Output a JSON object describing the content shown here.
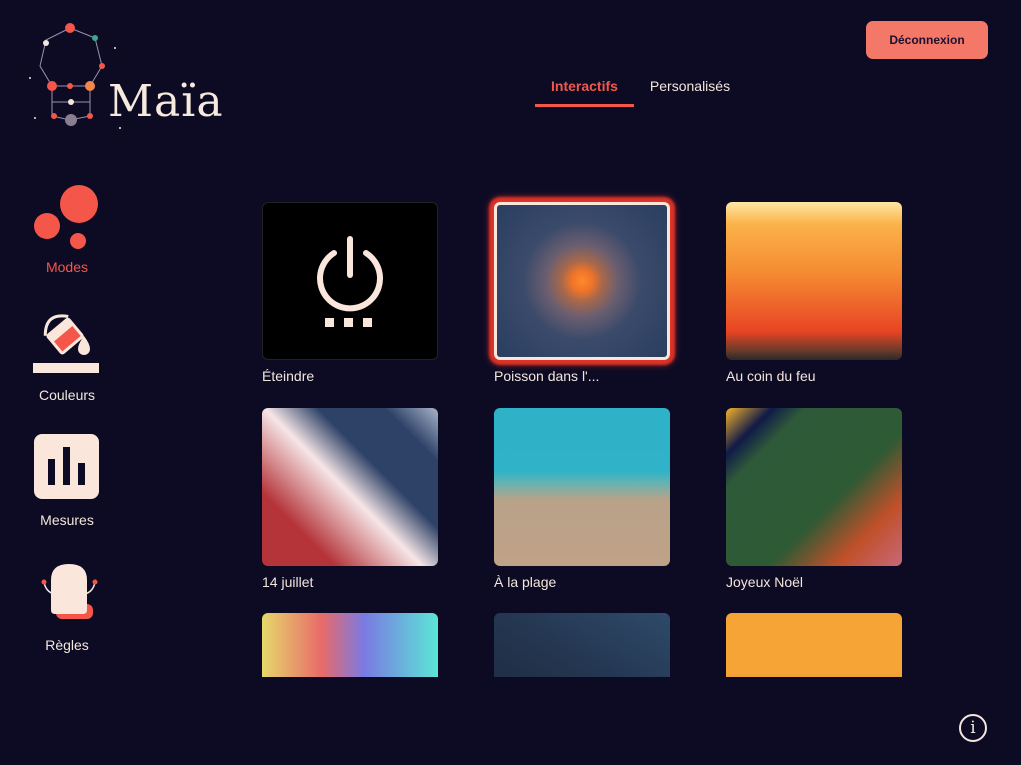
{
  "app": {
    "name": "Maïa",
    "logout_label": "Déconnexion"
  },
  "tabs": [
    {
      "label": "Interactifs",
      "active": true
    },
    {
      "label": "Personalisés",
      "active": false
    }
  ],
  "sidebar": {
    "items": [
      {
        "label": "Modes",
        "icon": "modes-bubbles-icon",
        "active": true
      },
      {
        "label": "Couleurs",
        "icon": "paint-bucket-icon",
        "active": false
      },
      {
        "label": "Mesures",
        "icon": "bar-chart-icon",
        "active": false
      },
      {
        "label": "Règles",
        "icon": "robot-icon",
        "active": false
      }
    ]
  },
  "modes": [
    {
      "label": "Éteindre",
      "preview": "power-icon"
    },
    {
      "label": "Poisson dans l'...",
      "selected": true
    },
    {
      "label": "Au coin du feu"
    },
    {
      "label": "14 juillet"
    },
    {
      "label": "À la plage"
    },
    {
      "label": "Joyeux Noël"
    },
    {
      "label": ""
    },
    {
      "label": ""
    },
    {
      "label": ""
    }
  ],
  "colors": {
    "background": "#0d0b24",
    "accent": "#f4564a",
    "button": "#f47867",
    "text": "#f3e6dc"
  },
  "info_icon": "info-icon"
}
